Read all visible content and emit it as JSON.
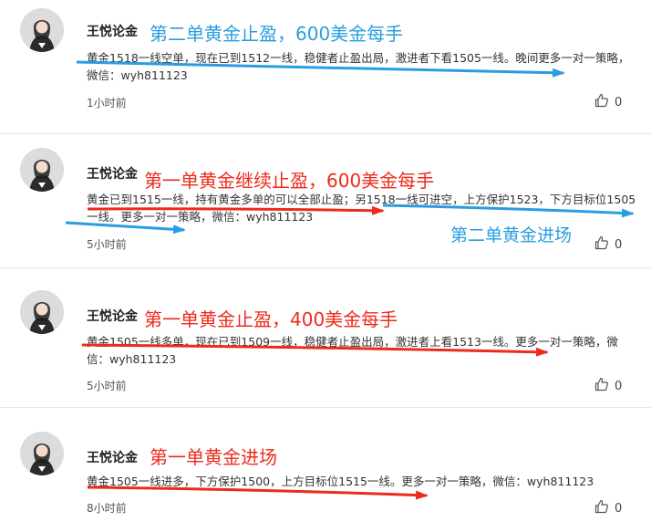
{
  "posts": [
    {
      "author": "王悦论金",
      "headline": "第二单黄金止盈，600美金每手",
      "headline_color": "#2a9ddf",
      "body": "黄金1518一线空单，现在已到1512一线，稳健者止盈出局，激进者下看1505一线。晚间更多一对一策略，微信：wyh811123",
      "time": "1小时前",
      "likes": "0"
    },
    {
      "author": "王悦论金",
      "headline": "第一单黄金继续止盈，600美金每手",
      "headline_color": "#ee2a1c",
      "extra_annotation": "第二单黄金进场",
      "extra_annotation_color": "#2a9ddf",
      "body": "黄金已到1515一线，持有黄金多单的可以全部止盈；另1518一线可进空，上方保护1523，下方目标位1505一线。更多一对一策略，微信：wyh811123",
      "time": "5小时前",
      "likes": "0"
    },
    {
      "author": "王悦论金",
      "headline": "第一单黄金止盈，400美金每手",
      "headline_color": "#ee2a1c",
      "body": "黄金1505一线多单，现在已到1509一线，稳健者止盈出局，激进者上看1513一线。更多一对一策略，微信：wyh811123",
      "time": "5小时前",
      "likes": "0"
    },
    {
      "author": "王悦论金",
      "headline": "第一单黄金进场",
      "headline_color": "#ee2a1c",
      "body": "黄金1505一线进多，下方保护1500，上方目标位1515一线。更多一对一策略，微信：wyh811123",
      "time": "8小时前",
      "likes": "0"
    }
  ],
  "colors": {
    "blue_arrow": "#2a9ddf",
    "red_arrow": "#ee2a1c"
  }
}
